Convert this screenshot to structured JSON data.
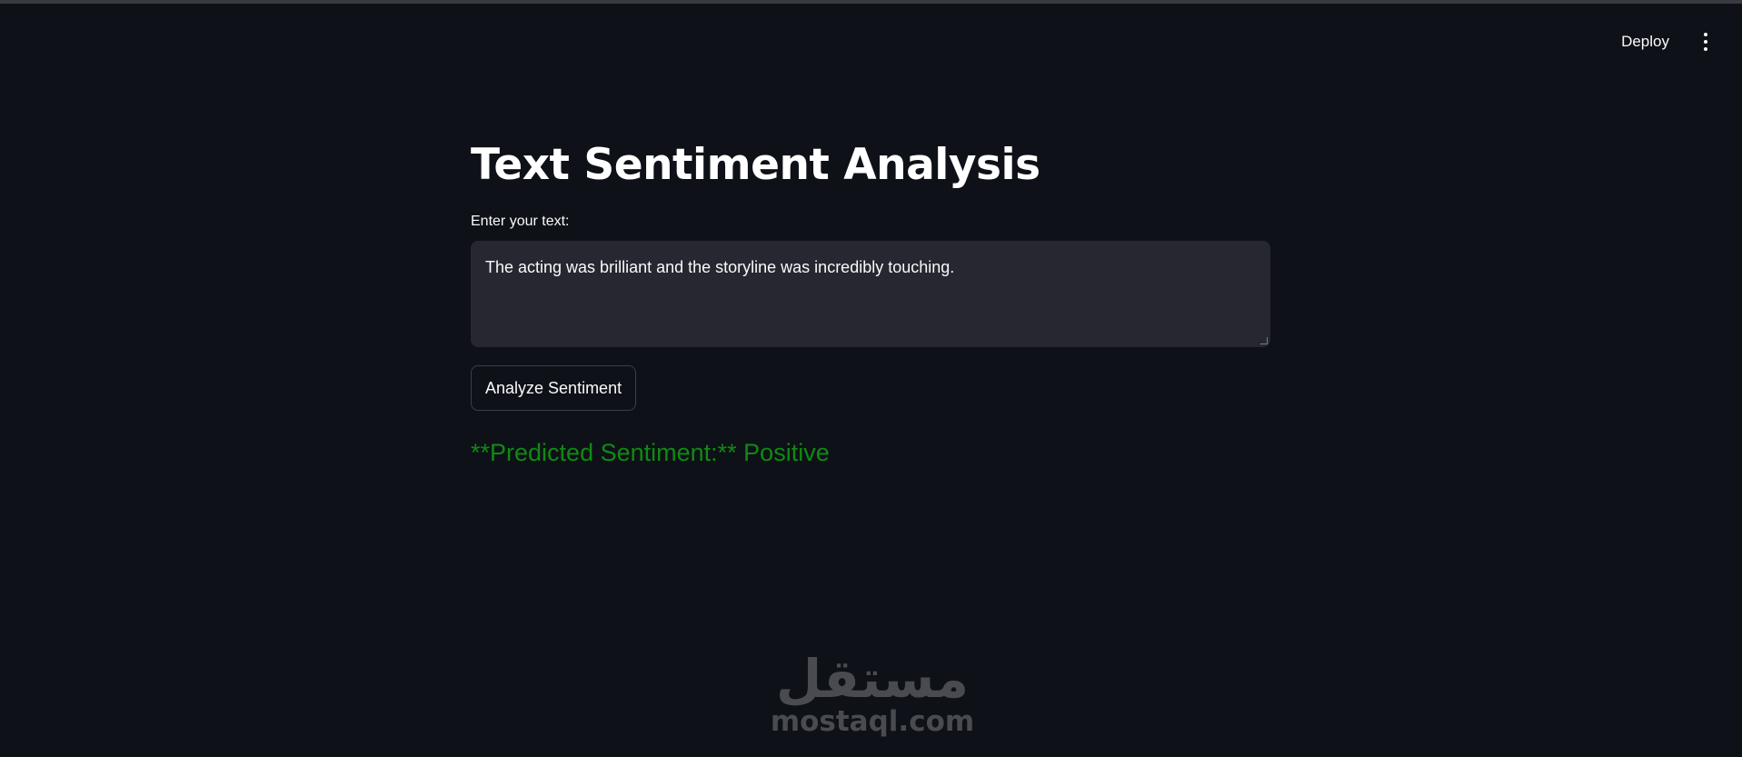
{
  "header": {
    "deploy_label": "Deploy",
    "menu_icon": "more-vertical-icon"
  },
  "main": {
    "title": "Text Sentiment Analysis",
    "input_label": "Enter your text:",
    "input_value": "The acting was brilliant and the storyline was incredibly touching.",
    "analyze_button": "Analyze Sentiment",
    "result_text": "**Predicted Sentiment:** Positive"
  },
  "watermark": {
    "arabic": "مستقل",
    "latin": "mostaql.com"
  },
  "colors": {
    "background": "#0e1117",
    "input_background": "#262730",
    "result_green": "#0f8a12",
    "watermark_gray": "#4a4b50"
  }
}
